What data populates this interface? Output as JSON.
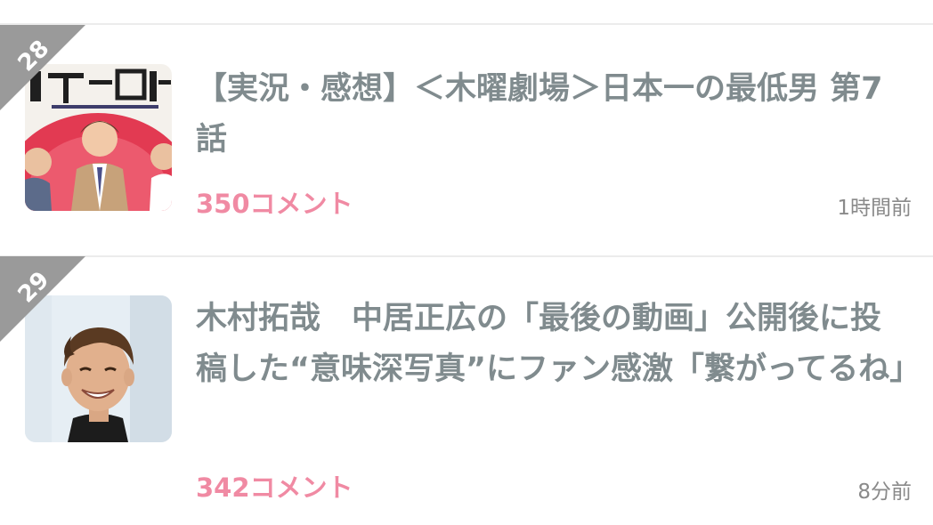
{
  "colors": {
    "title": "#808b8e",
    "comments_accent": "#f08aa3",
    "time": "#8a8a8a",
    "rank_ribbon": "#9a9a9a",
    "divider": "#ececec"
  },
  "items": [
    {
      "rank": "28",
      "title": "【実況・感想】＜木曜劇場＞日本一の最低男 第7話",
      "comment_count": "350コメント",
      "time_ago": "1時間前",
      "thumbnail_icon": "drama-poster-thumbnail"
    },
    {
      "rank": "29",
      "title": "木村拓哉　中居正広の「最後の動画」公開後に投稿した“意味深写真”にファン感激「繋がってるね」",
      "comment_count": "342コメント",
      "time_ago": "8分前",
      "thumbnail_icon": "portrait-photo-thumbnail"
    }
  ]
}
